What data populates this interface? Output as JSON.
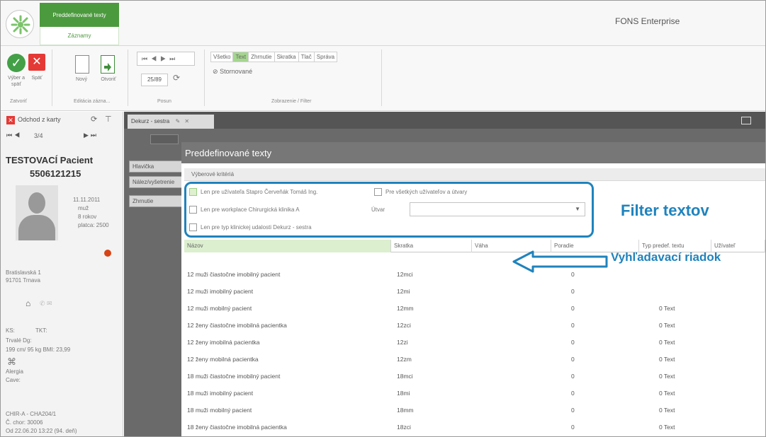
{
  "ribbon": {
    "tab_label": "Preddefinované texty",
    "subtab_label": "Záznamy",
    "app_title": "FONS Enterprise",
    "buttons": {
      "select_back": "Výber a späť",
      "back": "Späť",
      "new": "Nový",
      "open": "Otvoriť"
    },
    "groups": {
      "close": "Zatvoriť",
      "editing": "Editácia zázna...",
      "move": "Posun",
      "display_filter": "Zobrazenie / Filter"
    },
    "page_counter": "25/89",
    "filter_tabs": [
      "Všetko",
      "Text",
      "Zhrnutie",
      "Skratka",
      "Tlač",
      "Správa"
    ],
    "selected_filter": "Text",
    "cancelled_label": "Stornované"
  },
  "patient": {
    "leave_card": "Odchod z karty",
    "record_counter": "3/4",
    "name": "TESTOVACÍ Pacient",
    "id": "5506121215",
    "birth_date": "11.11.2011",
    "sex": "muž",
    "age": "8 rokov",
    "payer": "platca: 2500",
    "address_line1": "Bratislavská 1",
    "address_line2": "91701 Trnava",
    "ks_label": "KS:",
    "tkt_label": "TKT:",
    "permanent_dg": "Trvalé Dg:",
    "measurements": "199 cm/ 95 kg BMI: 23,99",
    "allergy": "Alergia",
    "cave": "Cave:",
    "department": "CHIR-A - CHA204/1",
    "case_no": "Č. chor: 30006",
    "date": "Od 22.06.20 13:22 (94. deň)"
  },
  "document": {
    "tab_label": "Dekurz - sestra",
    "side_buttons": [
      "Hlavička",
      "Nález/vyšetrenie",
      "Zhrnutie"
    ]
  },
  "dialog": {
    "title": "Preddefinované texty",
    "criteria_label": "Výberové kritériá",
    "filters": {
      "user_only": "Len pre užívateľa Stapro Červeňák Tomáš Ing.",
      "all_users": "Pre všetkých užívateľov a útvary",
      "workplace": "Len pre workplace Chirurgická klinika A",
      "unit_label": "Útvar",
      "event_type": "Len pre typ klinickej udalosti Dekurz - sestra"
    },
    "columns": [
      "Názov",
      "Skratka",
      "Váha",
      "Poradie",
      "Typ predef. textu",
      "Užívateľ"
    ],
    "rows": [
      {
        "name": "12 muži čiastočne imobilný pacient",
        "abbr": "12mci",
        "weight": "0",
        "type": ""
      },
      {
        "name": "12 muži imobilný pacient",
        "abbr": "12mi",
        "weight": "0",
        "type": ""
      },
      {
        "name": "12 muži mobilný pacient",
        "abbr": "12mm",
        "weight": "0",
        "type": "0 Text"
      },
      {
        "name": "12 ženy čiastočne imobilná pacientka",
        "abbr": "12zci",
        "weight": "0",
        "type": "0 Text"
      },
      {
        "name": "12 ženy imobilná pacientka",
        "abbr": "12zi",
        "weight": "0",
        "type": "0 Text"
      },
      {
        "name": "12 ženy mobilná pacientka",
        "abbr": "12zm",
        "weight": "0",
        "type": "0 Text"
      },
      {
        "name": "18 muži čiastočne imobilný pacient",
        "abbr": "18mci",
        "weight": "0",
        "type": "0 Text"
      },
      {
        "name": "18 muži imobilný pacient",
        "abbr": "18mi",
        "weight": "0",
        "type": "0 Text"
      },
      {
        "name": "18 muži mobilný pacient",
        "abbr": "18mm",
        "weight": "0",
        "type": "0 Text"
      },
      {
        "name": "18 ženy čiastočne imobilná pacientka",
        "abbr": "18zci",
        "weight": "0",
        "type": "0 Text"
      }
    ]
  },
  "annotations": {
    "filter_label": "Filter textov",
    "search_label": "Vyhľadavací riadok",
    "color": "#1f83bd"
  }
}
